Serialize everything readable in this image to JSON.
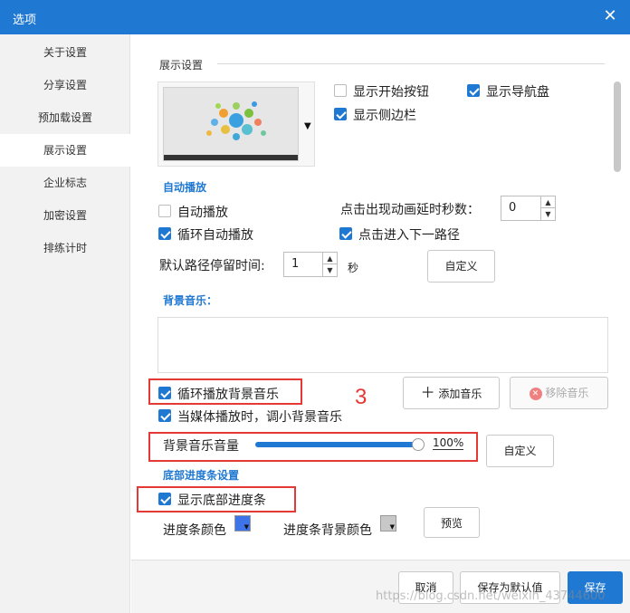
{
  "window": {
    "title": "选项",
    "close_glyph": "✕"
  },
  "sidebar": {
    "items": [
      {
        "label": "关于设置"
      },
      {
        "label": "分享设置"
      },
      {
        "label": "预加载设置"
      },
      {
        "label": "展示设置",
        "active": true
      },
      {
        "label": "企业标志"
      },
      {
        "label": "加密设置"
      },
      {
        "label": "排练计时"
      }
    ]
  },
  "display": {
    "section_title": "展示设置",
    "show_start_button": {
      "label": "显示开始按钮",
      "checked": false
    },
    "show_navigator": {
      "label": "显示导航盘",
      "checked": true
    },
    "show_sidebar": {
      "label": "显示侧边栏",
      "checked": true
    }
  },
  "autoplay": {
    "section_title": "自动播放",
    "autoplay": {
      "label": "自动播放",
      "checked": false
    },
    "loop_autoplay": {
      "label": "循环自动播放",
      "checked": true
    },
    "delay_label": "点击出现动画延时秒数：",
    "delay_value": "0",
    "click_next": {
      "label": "点击进入下一路径",
      "checked": true
    },
    "default_stay_label": "默认路径停留时间:",
    "default_stay_value": "1",
    "seconds_unit": "秒",
    "custom_button": "自定义"
  },
  "music": {
    "section_title": "背景音乐：",
    "loop_music": {
      "label": "循环播放背景音乐",
      "checked": true
    },
    "lower_music": {
      "label": "当媒体播放时，调小背景音乐",
      "checked": true
    },
    "add_button": "添加音乐",
    "remove_button": "移除音乐",
    "volume_label": "背景音乐音量",
    "volume_percent": 100,
    "volume_text": "100%",
    "custom_button": "自定义"
  },
  "annotation": {
    "number": "3"
  },
  "progress": {
    "section_title": "底部进度条设置",
    "show_progress": {
      "label": "显示底部进度条",
      "checked": true
    },
    "color_label": "进度条颜色",
    "bg_color_label": "进度条背景颜色",
    "preview_button": "预览",
    "color": "#3f74e8",
    "bg_color": "#c8c8c8"
  },
  "footer": {
    "cancel": "取消",
    "save_default": "保存为默认值",
    "save": "保存"
  },
  "watermark": "https://blog.csdn.net/weixin_43744600",
  "colors": {
    "accent": "#1f78d1",
    "annotation_red": "#e53935"
  }
}
